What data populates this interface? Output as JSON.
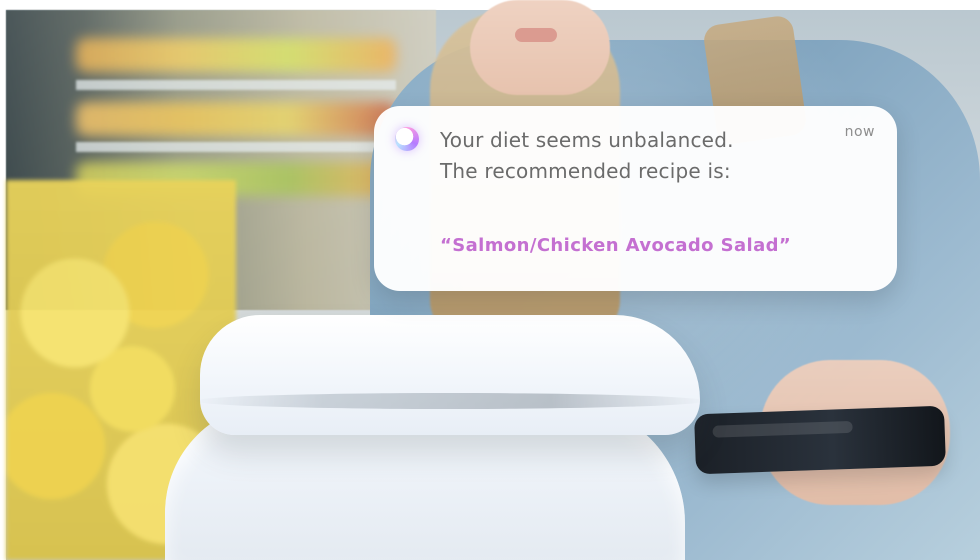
{
  "notification": {
    "message_line1": "Your diet seems unbalanced.",
    "message_line2": "The recommended recipe is:",
    "recipe": "“Salmon/Chicken Avocado Salad”",
    "time": "now",
    "icon": "app-orb-icon",
    "accent_color": "#c470d1"
  }
}
